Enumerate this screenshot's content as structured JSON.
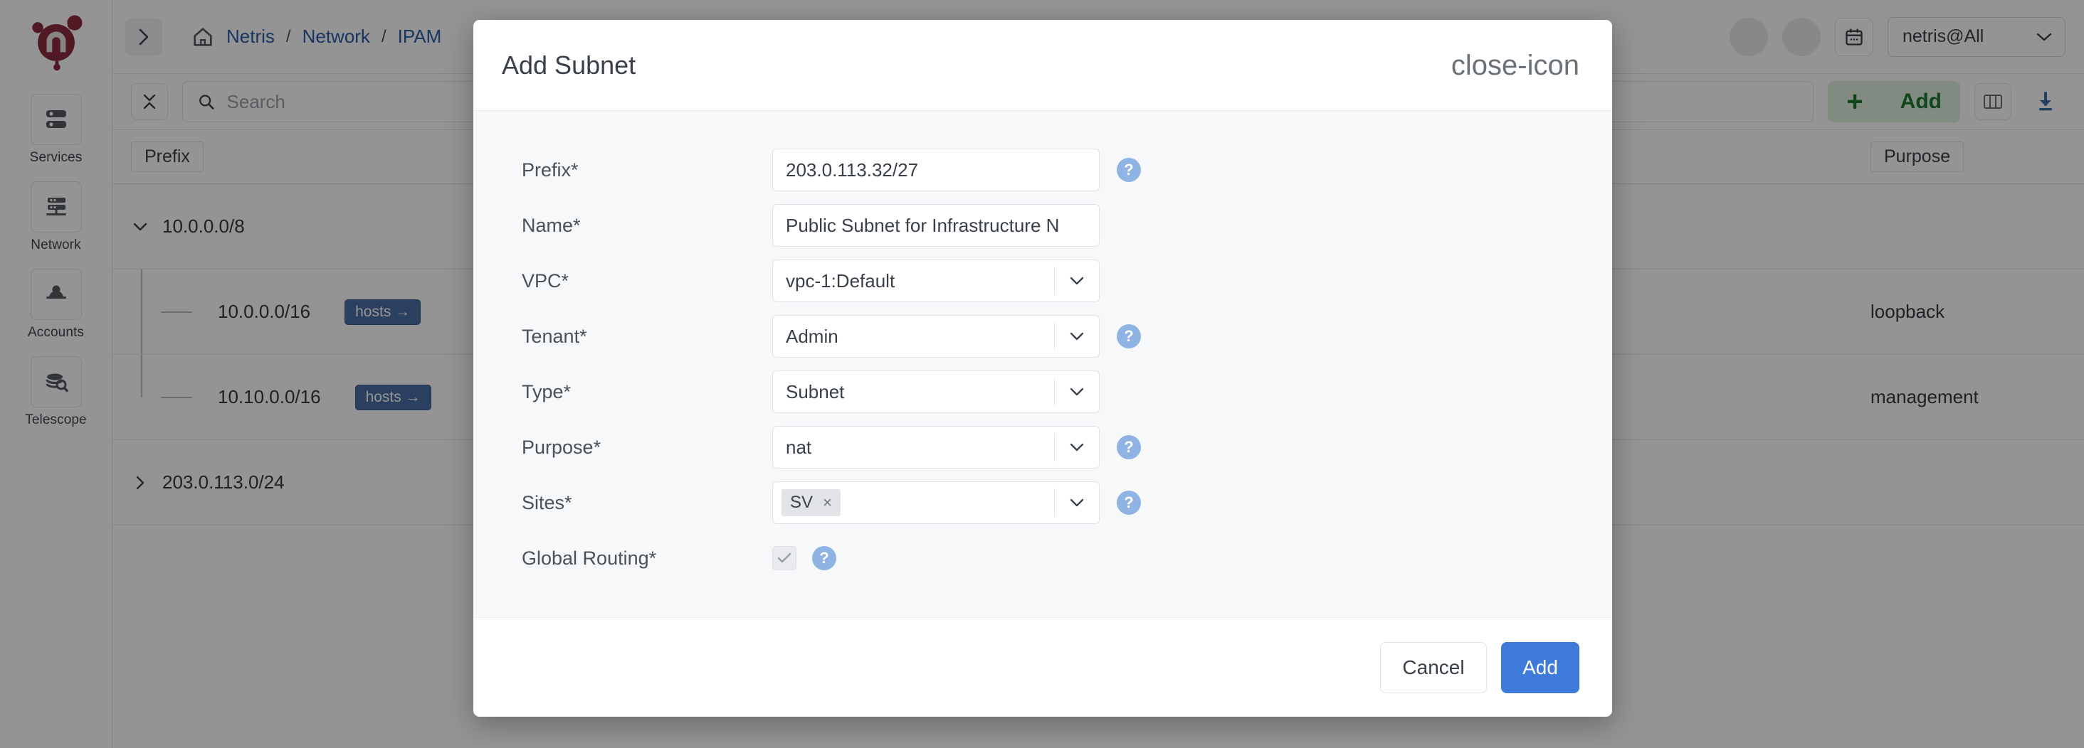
{
  "app": {
    "brand": "Netris",
    "logo_color": "#8c2b3f"
  },
  "sidebar": {
    "collapse_toggle": "›",
    "items": [
      {
        "label": "Services",
        "icon": "services-stack-icon"
      },
      {
        "label": "Network",
        "icon": "network-switch-icon"
      },
      {
        "label": "Accounts",
        "icon": "accounts-user-icon"
      },
      {
        "label": "Telescope",
        "icon": "telescope-search-icon"
      }
    ]
  },
  "header": {
    "home_icon": "home-icon",
    "breadcrumb": [
      {
        "label": "Netris"
      },
      {
        "label": "Network"
      },
      {
        "label": "IPAM"
      }
    ],
    "separator": "/",
    "calendar_icon": "calendar-icon",
    "account": {
      "value": "netris@All",
      "chevron": "chevron-down-icon"
    }
  },
  "toolbar": {
    "collapse_all_icon": "collapse-all-icon",
    "search": {
      "placeholder": "Search",
      "value": "",
      "icon": "search-icon"
    },
    "add_button": {
      "label": "Add",
      "plus": "+",
      "color": "#1c7a2e",
      "background": "#e0f0e0"
    },
    "columns_icon": "columns-layout-icon",
    "download_icon": "download-icon"
  },
  "table": {
    "columns": [
      "Prefix",
      "",
      "Purpose",
      ""
    ],
    "rows": [
      {
        "prefix": "10.0.0.0/8",
        "expanded": true,
        "depth": 0,
        "badge": "",
        "purpose": "",
        "actions": "row-menu-icon"
      },
      {
        "prefix": "10.0.0.0/16",
        "expanded": false,
        "depth": 1,
        "badge": "hosts →",
        "purpose": "loopback",
        "actions": "row-menu-icon"
      },
      {
        "prefix": "10.10.0.0/16",
        "expanded": false,
        "depth": 1,
        "badge": "hosts →",
        "purpose": "management",
        "actions": "row-menu-icon"
      },
      {
        "prefix": "203.0.113.0/24",
        "expanded": false,
        "depth": 0,
        "badge": "",
        "purpose": "",
        "actions": "row-menu-icon"
      }
    ]
  },
  "modal": {
    "title": "Add Subnet",
    "close_icon": "close-icon",
    "help_icon_color": "#8fb3e3",
    "fields": [
      {
        "label": "Prefix*",
        "type": "text",
        "value": "203.0.113.32/27",
        "help": true
      },
      {
        "label": "Name*",
        "type": "text",
        "value": "Public Subnet for Infrastructure N",
        "help": false
      },
      {
        "label": "VPC*",
        "type": "select",
        "value": "vpc-1:Default",
        "help": false
      },
      {
        "label": "Tenant*",
        "type": "select",
        "value": "Admin",
        "help": true
      },
      {
        "label": "Type*",
        "type": "select",
        "value": "Subnet",
        "help": false
      },
      {
        "label": "Purpose*",
        "type": "select",
        "value": "nat",
        "help": true
      },
      {
        "label": "Sites*",
        "type": "tags",
        "value": "SV",
        "tag_remove": "×",
        "help": true
      },
      {
        "label": "Global Routing*",
        "type": "checkbox",
        "value": "checked",
        "checkmark": "✓",
        "help": true
      }
    ],
    "footer": {
      "cancel_label": "Cancel",
      "submit_label": "Add",
      "submit_color": "#3d7ada"
    }
  }
}
